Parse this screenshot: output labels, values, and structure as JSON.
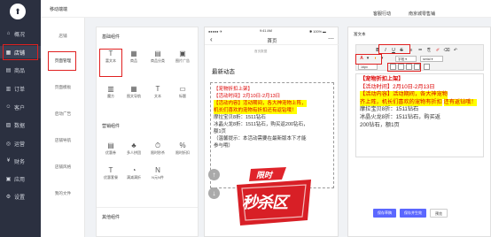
{
  "app": {
    "logo": "⬆"
  },
  "nav": {
    "items": [
      {
        "label": "概况",
        "icon": "⌂"
      },
      {
        "label": "店铺",
        "icon": "▦"
      },
      {
        "label": "商品",
        "icon": "▤"
      },
      {
        "label": "订单",
        "icon": "▥"
      },
      {
        "label": "客户",
        "icon": "☺"
      },
      {
        "label": "数据",
        "icon": "▨"
      },
      {
        "label": "运营",
        "icon": "◎"
      },
      {
        "label": "财务",
        "icon": "¥"
      },
      {
        "label": "应用",
        "icon": "▣"
      },
      {
        "label": "设置",
        "icon": "⚙"
      }
    ]
  },
  "sub_nav": {
    "items": [
      "店铺",
      "页面管理",
      "页面模板",
      "启动广告",
      "店铺导航",
      "店铺风格",
      "我的文件"
    ]
  },
  "topbar": {
    "title": "移动端端",
    "help": "客服行动",
    "user": "南京城零售铺"
  },
  "components": {
    "basic_title": "基础组件",
    "basic": [
      {
        "label": "富文本",
        "icon": "T"
      },
      {
        "label": "商品",
        "icon": "▦"
      },
      {
        "label": "商品分类",
        "icon": "▤"
      },
      {
        "label": "图片广告",
        "icon": "▣"
      },
      {
        "label": "魔方",
        "icon": "▥"
      },
      {
        "label": "图文导航",
        "icon": "▦"
      },
      {
        "label": "文本",
        "icon": "T"
      },
      {
        "label": "标题",
        "icon": "▭"
      }
    ],
    "marketing_title": "营销组件",
    "marketing": [
      {
        "label": "优惠券",
        "icon": "▤"
      },
      {
        "label": "多人拼团",
        "icon": "♣"
      },
      {
        "label": "限时秒杀",
        "icon": "⏱"
      },
      {
        "label": "限时折扣",
        "icon": "%"
      },
      {
        "label": "优惠套餐",
        "icon": "T"
      },
      {
        "label": "满减满折",
        "icon": "◔"
      },
      {
        "label": "N元N件",
        "icon": "N"
      }
    ],
    "other_title": "其他组件"
  },
  "phone": {
    "carrier": "●●●●● ✈",
    "time": "9:41 AM",
    "battery": "✱ 100% ▬",
    "title": "首页",
    "crumb": "首页数据",
    "news_title": "最新动态",
    "lines": [
      "【宠物折扣上架】",
      "【活动时间】2月10日-2月13日",
      "【活动内容】活动期间，各大神宠物上阵，",
      "机长们喜欢的宠物有折扣还有返钻哦！",
      "摩拉宝贝8折：1511钻石",
      "冰晶火龙8折：1511钻石，购买返200钻石，",
      "额1页",
      "（温馨提示：本活动需要在最新版本下才能",
      "参与哦）"
    ],
    "promo_top": "限时",
    "promo_main": "秒杀区",
    "fab_up": "↑",
    "fab_down": "↓"
  },
  "editor": {
    "label": "富文本",
    "tools_row1": [
      "B",
      "I",
      "U",
      "S",
      "≡",
      "≔",
      "⎘",
      "✐",
      "⌫",
      "↶"
    ],
    "tools_row2": [
      "A",
      "▾",
      "◐",
      "▾",
      "字段",
      "▾",
      "serial",
      "▾"
    ],
    "font_size": "16px",
    "content": [
      "【宠物折扣上架】",
      "【活动时间】2月10日-2月13日",
      "【活动内容】活动期间，各大神宠物",
      "齐上阵，机长们喜欢的宠物有折扣",
      "还有返钻哦！",
      "摩拉宝贝8折：1511钻石",
      "冰晶火龙8折：1511钻石，购买返",
      "200钻石，额1页"
    ],
    "buttons": {
      "save_draft": "保存草稿",
      "save_publish": "保存并生效",
      "preview": "预览"
    }
  }
}
